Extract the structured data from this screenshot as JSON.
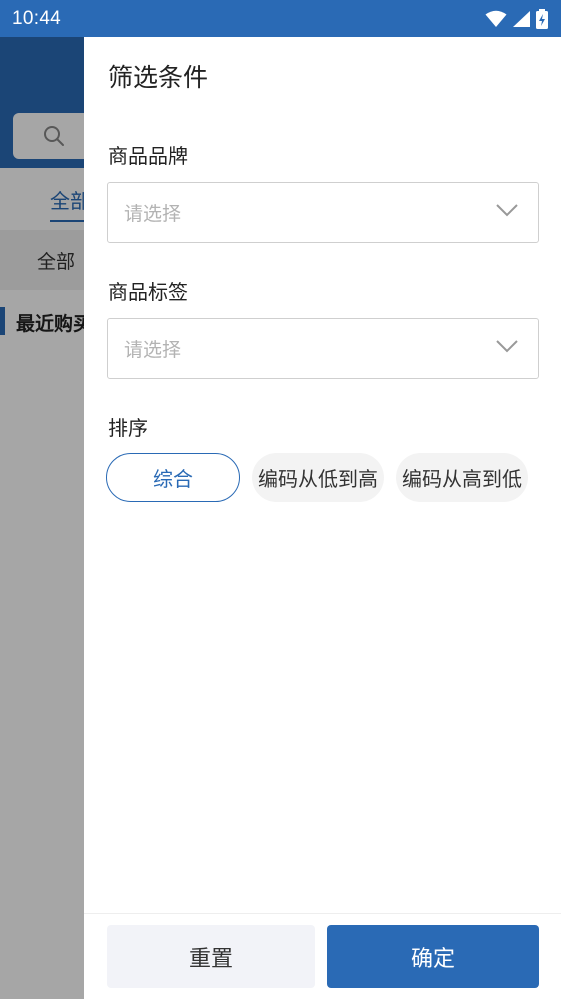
{
  "status_bar": {
    "time": "10:44",
    "icons": [
      "wifi-icon",
      "signal-icon",
      "battery-icon"
    ]
  },
  "background": {
    "tab_label": "全部",
    "category_label": "全部",
    "section_label": "最近购买"
  },
  "drawer": {
    "title": "筛选条件",
    "brand": {
      "label": "商品品牌",
      "placeholder": "请选择"
    },
    "tag": {
      "label": "商品标签",
      "placeholder": "请选择"
    },
    "sort": {
      "label": "排序",
      "options": [
        {
          "label": "综合",
          "selected": true
        },
        {
          "label": "编码从低到高",
          "selected": false
        },
        {
          "label": "编码从高到低",
          "selected": false
        }
      ]
    },
    "footer": {
      "reset_label": "重置",
      "confirm_label": "确定"
    }
  },
  "colors": {
    "primary": "#2a6ab5",
    "chip_bg": "#f3f3f3",
    "reset_bg": "#f2f3f8"
  }
}
